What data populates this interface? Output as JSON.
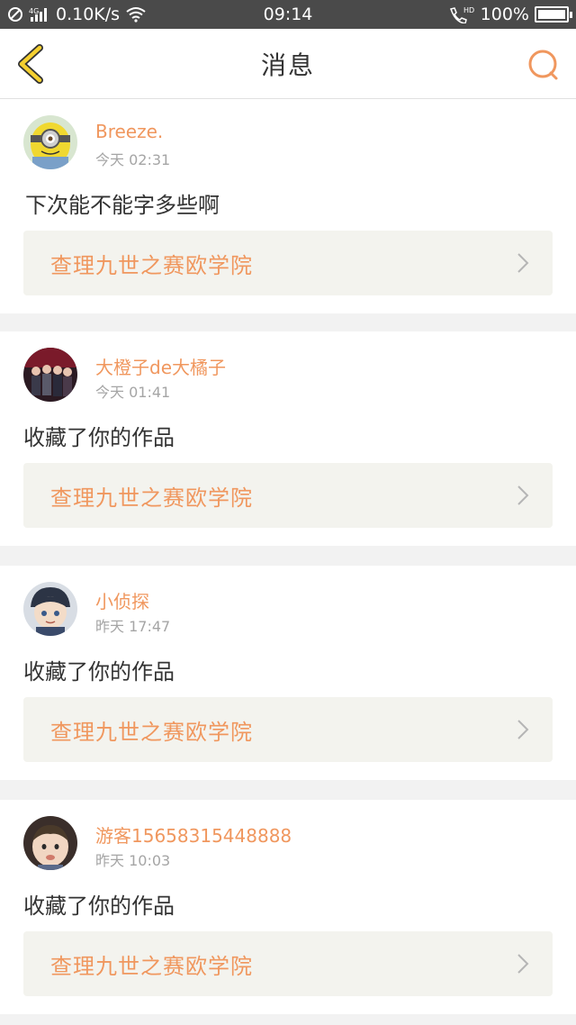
{
  "status_bar": {
    "network_speed": "0.10K/s",
    "time": "09:14",
    "battery": "100%"
  },
  "header": {
    "title": "消息"
  },
  "messages": [
    {
      "username": "Breeze.",
      "time": "今天 02:31",
      "text": "下次能不能字多些啊",
      "work_title": "查理九世之赛欧学院"
    },
    {
      "username": "大橙子de大橘子",
      "time": "今天 01:41",
      "text": "收藏了你的作品",
      "work_title": "查理九世之赛欧学院"
    },
    {
      "username": "小侦探",
      "time": "昨天 17:47",
      "text": "收藏了你的作品",
      "work_title": "查理九世之赛欧学院"
    },
    {
      "username": "游客15658315448888",
      "time": "昨天 10:03",
      "text": "收藏了你的作品",
      "work_title": "查理九世之赛欧学院"
    }
  ],
  "colors": {
    "accent": "#f0975e",
    "back_arrow": "#f5d030",
    "status_bar": "#4a4a4a"
  }
}
